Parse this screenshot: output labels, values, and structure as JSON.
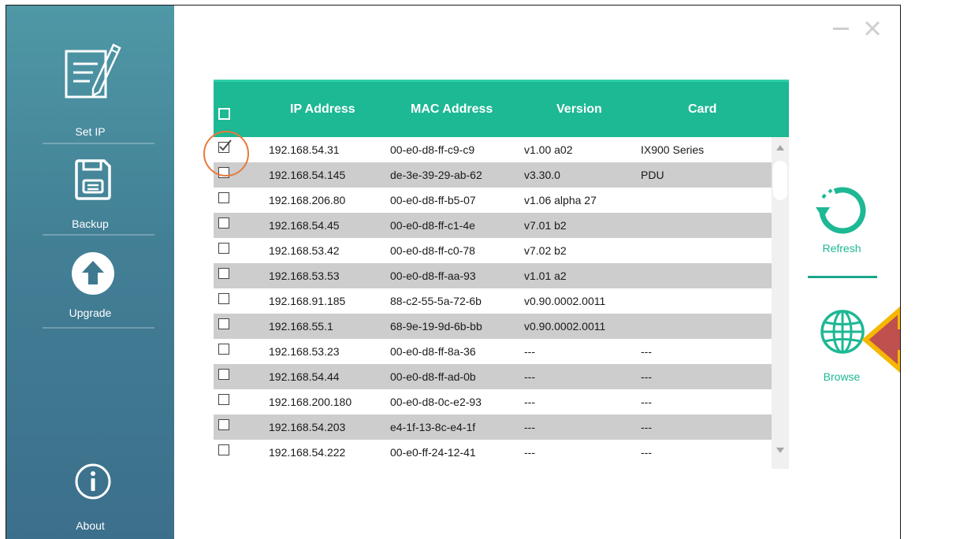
{
  "sidebar": {
    "items": [
      {
        "label": "Set IP",
        "icon": "set-ip-icon"
      },
      {
        "label": "Backup",
        "icon": "floppy-disk-icon"
      },
      {
        "label": "Upgrade",
        "icon": "upload-arrow-icon"
      }
    ],
    "about": {
      "label": "About",
      "icon": "info-icon"
    }
  },
  "window_controls": {
    "minimize": "minimize-icon",
    "close": "close-icon"
  },
  "table": {
    "columns": [
      "IP Address",
      "MAC Address",
      "Version",
      "Card"
    ],
    "rows": [
      {
        "checked": true,
        "ip": "192.168.54.31",
        "mac": "00-e0-d8-ff-c9-c9",
        "version": "v1.00 a02",
        "card": "IX900 Series"
      },
      {
        "checked": false,
        "ip": "192.168.54.145",
        "mac": "de-3e-39-29-ab-62",
        "version": "v3.30.0",
        "card": "PDU"
      },
      {
        "checked": false,
        "ip": "192.168.206.80",
        "mac": "00-e0-d8-ff-b5-07",
        "version": "v1.06 alpha 27",
        "card": ""
      },
      {
        "checked": false,
        "ip": "192.168.54.45",
        "mac": "00-e0-d8-ff-c1-4e",
        "version": "v7.01 b2",
        "card": ""
      },
      {
        "checked": false,
        "ip": "192.168.53.42",
        "mac": "00-e0-d8-ff-c0-78",
        "version": "v7.02 b2",
        "card": ""
      },
      {
        "checked": false,
        "ip": "192.168.53.53",
        "mac": "00-e0-d8-ff-aa-93",
        "version": "v1.01 a2",
        "card": ""
      },
      {
        "checked": false,
        "ip": "192.168.91.185",
        "mac": "88-c2-55-5a-72-6b",
        "version": "v0.90.0002.0011",
        "card": ""
      },
      {
        "checked": false,
        "ip": "192.168.55.1",
        "mac": "68-9e-19-9d-6b-bb",
        "version": "v0.90.0002.0011",
        "card": ""
      },
      {
        "checked": false,
        "ip": "192.168.53.23",
        "mac": "00-e0-d8-ff-8a-36",
        "version": "---",
        "card": "---"
      },
      {
        "checked": false,
        "ip": "192.168.54.44",
        "mac": "00-e0-d8-ff-ad-0b",
        "version": "---",
        "card": "---"
      },
      {
        "checked": false,
        "ip": "192.168.200.180",
        "mac": "00-e0-d8-0c-e2-93",
        "version": "---",
        "card": "---"
      },
      {
        "checked": false,
        "ip": "192.168.54.203",
        "mac": "e4-1f-13-8c-e4-1f",
        "version": "---",
        "card": "---"
      },
      {
        "checked": false,
        "ip": "192.168.54.222",
        "mac": "00-e0-ff-24-12-41",
        "version": "---",
        "card": "---"
      }
    ]
  },
  "actions": {
    "refresh": {
      "label": "Refresh",
      "icon": "refresh-icon"
    },
    "browse": {
      "label": "Browse",
      "icon": "globe-icon"
    }
  },
  "colors": {
    "accent": "#1db894",
    "sidebar_top": "#4f98a6",
    "sidebar_bottom": "#3c6f8c",
    "highlight_circle": "#e87a3a",
    "arrow_fill": "#c0504d",
    "arrow_border": "#f5b800"
  }
}
